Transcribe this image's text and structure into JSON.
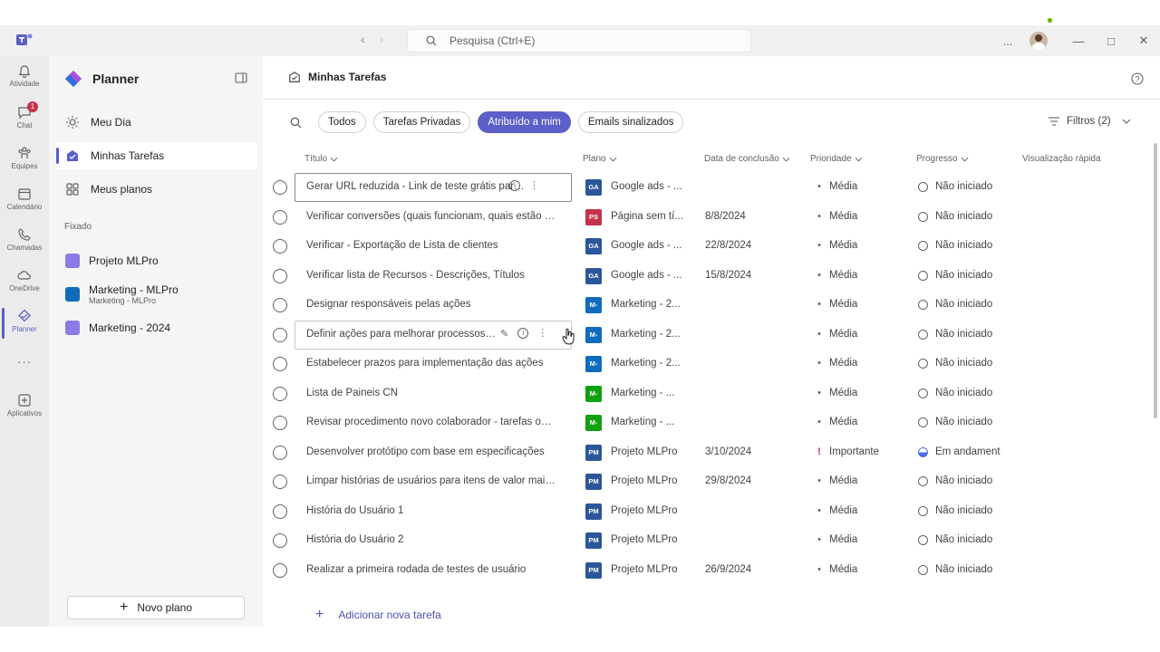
{
  "titlebar": {
    "search_placeholder": "Pesquisa (Ctrl+E)",
    "more_label": "...",
    "minimize": "—",
    "maximize": "□",
    "close": "✕"
  },
  "rail": {
    "items": [
      {
        "label": "Atividade",
        "icon": "bell-icon"
      },
      {
        "label": "Chat",
        "icon": "chat-icon",
        "badge": "1"
      },
      {
        "label": "Equipes",
        "icon": "teams-icon"
      },
      {
        "label": "Calendário",
        "icon": "calendar-icon"
      },
      {
        "label": "Chamadas",
        "icon": "phone-icon"
      },
      {
        "label": "OneDrive",
        "icon": "cloud-icon"
      },
      {
        "label": "Planner",
        "icon": "planner-icon"
      },
      {
        "label": "Aplicativos",
        "icon": "apps-icon"
      }
    ],
    "more": "···"
  },
  "sidebar": {
    "app_name": "Planner",
    "nav": [
      {
        "label": "Meu Dia",
        "icon": "sun-icon"
      },
      {
        "label": "Minhas Tarefas",
        "icon": "tasks-icon"
      },
      {
        "label": "Meus planos",
        "icon": "grid-icon"
      }
    ],
    "pinned_label": "Fixado",
    "pinned": [
      {
        "label": "Projeto MLPro",
        "sub": ""
      },
      {
        "label": "Marketing - MLPro",
        "sub": "Marketing - MLPro"
      },
      {
        "label": "Marketing - 2024",
        "sub": ""
      }
    ],
    "new_plan": "Novo plano"
  },
  "main": {
    "title": "Minhas Tarefas",
    "chips": [
      "Todos",
      "Tarefas Privadas",
      "Atribuído a mim",
      "Emails sinalizados"
    ],
    "selected_chip": "Atribuído a mim",
    "filters": "Filtros (2)",
    "columns": {
      "title": "Título",
      "plan": "Plano",
      "due": "Data de conclusão",
      "priority": "Prioridade",
      "progress": "Progresso",
      "quick_view": "Visualização rápida"
    },
    "add_task": "Adicionar nova tarefa"
  },
  "tasks": [
    {
      "title": "Gerar URL reduzida - Link de teste grátis para ad",
      "plan_abbr": "GA",
      "plan_color": "#2b579a",
      "plan": "Google ads - ...",
      "due": "",
      "priority": "Média",
      "progress": "Não iniciado"
    },
    {
      "title": "Verificar conversões (quais funcionam, quais estão du...",
      "plan_abbr": "PS",
      "plan_color": "#c4314b",
      "plan": "Página sem tí...",
      "due": "8/8/2024",
      "priority": "Média",
      "progress": "Não iniciado"
    },
    {
      "title": "Verificar - Exportação de Lista de clientes",
      "plan_abbr": "GA",
      "plan_color": "#2b579a",
      "plan": "Google ads - ...",
      "due": "22/8/2024",
      "priority": "Média",
      "progress": "Não iniciado"
    },
    {
      "title": "Verificar lista de Recursos - Descrições, Títulos",
      "plan_abbr": "GA",
      "plan_color": "#2b579a",
      "plan": "Google ads - ...",
      "due": "15/8/2024",
      "priority": "Média",
      "progress": "Não iniciado"
    },
    {
      "title": "Designar responsáveis pelas ações",
      "plan_abbr": "M-",
      "plan_color": "#0f6cbd",
      "plan": "Marketing - 2...",
      "due": "",
      "priority": "Média",
      "progress": "Não iniciado"
    },
    {
      "title": "Definir ações para melhorar processos futuros",
      "plan_abbr": "M-",
      "plan_color": "#0f6cbd",
      "plan": "Marketing - 2...",
      "due": "",
      "priority": "Média",
      "progress": "Não iniciado"
    },
    {
      "title": "Estabelecer prazos para implementação das ações",
      "plan_abbr": "M-",
      "plan_color": "#0f6cbd",
      "plan": "Marketing - 2...",
      "due": "",
      "priority": "Média",
      "progress": "Não iniciado"
    },
    {
      "title": "Lista de Paineis CN",
      "plan_abbr": "M-",
      "plan_color": "#13a10e",
      "plan": "Marketing - ...",
      "due": "",
      "priority": "Média",
      "progress": "Não iniciado"
    },
    {
      "title": "Revisar procedimento novo colaborador - tarefas outl...",
      "plan_abbr": "M-",
      "plan_color": "#13a10e",
      "plan": "Marketing - ...",
      "due": "",
      "priority": "Média",
      "progress": "Não iniciado"
    },
    {
      "title": "Desenvolver protótipo com base em especificações",
      "plan_abbr": "PM",
      "plan_color": "#2b579a",
      "plan": "Projeto MLPro",
      "due": "3/10/2024",
      "priority": "Importante",
      "progress": "Em andament"
    },
    {
      "title": "Limpar histórias de usuários para itens de valor mais a...",
      "plan_abbr": "PM",
      "plan_color": "#2b579a",
      "plan": "Projeto MLPro",
      "due": "29/8/2024",
      "priority": "Média",
      "progress": "Não iniciado"
    },
    {
      "title": "História do Usuário 1",
      "plan_abbr": "PM",
      "plan_color": "#2b579a",
      "plan": "Projeto MLPro",
      "due": "",
      "priority": "Média",
      "progress": "Não iniciado"
    },
    {
      "title": "História do Usuário 2",
      "plan_abbr": "PM",
      "plan_color": "#2b579a",
      "plan": "Projeto MLPro",
      "due": "",
      "priority": "Média",
      "progress": "Não iniciado"
    },
    {
      "title": "Realizar a primeira rodada de testes de usuário",
      "plan_abbr": "PM",
      "plan_color": "#2b579a",
      "plan": "Projeto MLPro",
      "due": "26/9/2024",
      "priority": "Média",
      "progress": "Não iniciado"
    }
  ]
}
